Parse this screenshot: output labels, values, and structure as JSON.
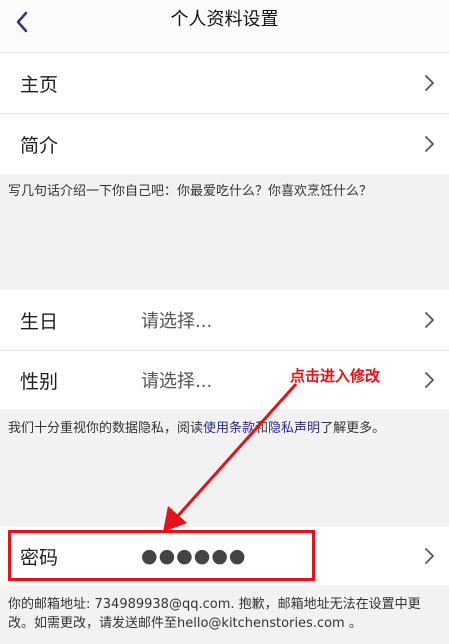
{
  "header": {
    "title": "个人资料设置",
    "back_icon": "chevron-left-icon"
  },
  "rows": {
    "homepage": {
      "label": "主页"
    },
    "bio": {
      "label": "简介"
    },
    "birthday": {
      "label": "生日",
      "value": "请选择..."
    },
    "gender": {
      "label": "性别",
      "value": "请选择..."
    },
    "password": {
      "label": "密码",
      "value": "●●●●●●"
    }
  },
  "bio_note": "写几句话介绍一下你自己吧：你最爱吃什么？你喜欢烹饪什么？",
  "privacy_note": {
    "before": "我们十分重视你的数据隐私，阅读",
    "terms_link": "使用条款",
    "and": "和",
    "privacy_link": "隐私声明",
    "after": "了解更多。"
  },
  "email_note": "你的邮箱地址: 734989938@qq.com. 抱歉，邮箱地址无法在设置中更改。如需更改，请发送邮件至hello@kitchenstories.com 。",
  "annotation": {
    "text": "点击进入修改",
    "color": "#e0151a"
  },
  "colors": {
    "link": "#2e2a8c",
    "back_icon": "#3b3175",
    "highlight": "#e5121b"
  }
}
